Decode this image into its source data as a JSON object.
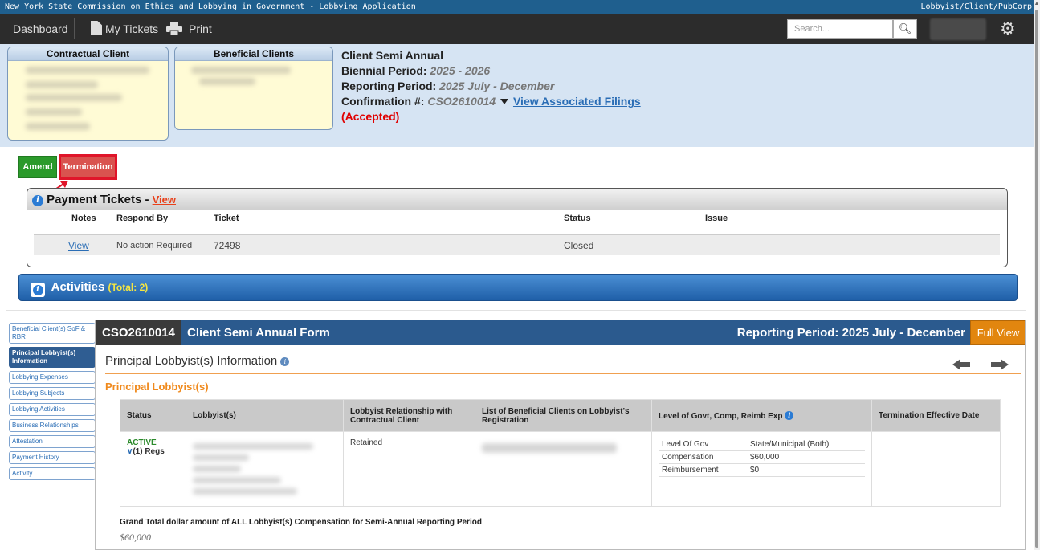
{
  "app": {
    "title": "New York State Commission on Ethics and Lobbying in Government - Lobbying Application",
    "role": "Lobbyist/Client/PubCorp"
  },
  "nav": {
    "dashboard": "Dashboard",
    "my_tickets": "My Tickets",
    "print": "Print",
    "search_placeholder": "Search...",
    "search_icon": "search-icon",
    "settings_icon": "gear-icon"
  },
  "header": {
    "contractual_client": "Contractual Client",
    "beneficial_clients": "Beneficial Clients",
    "form_name": "Client Semi Annual",
    "biennial_label": "Biennial Period:",
    "biennial_value": "2025 - 2026",
    "reporting_label": "Reporting Period:",
    "reporting_value": "2025 July - December",
    "confirmation_label": "Confirmation #:",
    "confirmation_value": "CSO2610014",
    "associated_link": "View Associated Filings",
    "status": "(Accepted)"
  },
  "actions": {
    "amend": "Amend",
    "termination": "Termination"
  },
  "payment_tickets": {
    "title": "Payment Tickets - ",
    "view_link": "View",
    "columns": [
      "Notes",
      "Respond By",
      "Ticket",
      "Status",
      "Issue"
    ],
    "rows": [
      {
        "notes": "View",
        "respond_by": "No action Required",
        "ticket": "72498",
        "status": "Closed",
        "issue": ""
      }
    ]
  },
  "activities": {
    "title": "Activities",
    "total": "(Total: 2)"
  },
  "sidebar": {
    "items": [
      {
        "label": "Beneficial Client(s) SoF & RBR",
        "active": false
      },
      {
        "label": "Principal Lobbyist(s) Information",
        "active": true
      },
      {
        "label": "Lobbying Expenses",
        "active": false
      },
      {
        "label": "Lobbying Subjects",
        "active": false
      },
      {
        "label": "Lobbying Activities",
        "active": false
      },
      {
        "label": "Business Relationships",
        "active": false
      },
      {
        "label": "Attestation",
        "active": false
      },
      {
        "label": "Payment History",
        "active": false
      },
      {
        "label": "Activity",
        "active": false
      }
    ]
  },
  "form": {
    "id": "CSO2610014",
    "title": "Client Semi Annual Form",
    "period": "Reporting Period: 2025 July - December",
    "full_view": "Full View",
    "section_title": "Principal Lobbyist(s) Information",
    "subsection_title": "Principal Lobbyist(s)",
    "table": {
      "columns": [
        "Status",
        "Lobbyist(s)",
        "Lobbyist Relationship with Contractual Client",
        "List of Beneficial Clients on Lobbyist's Registration",
        "Level of Govt, Comp, Reimb Exp",
        "Termination Effective Date"
      ],
      "row": {
        "status": "ACTIVE",
        "regs": "(1) Regs",
        "relationship": "Retained",
        "level_of_gov_label": "Level Of Gov",
        "level_of_gov_value": "State/Municipal (Both)",
        "compensation_label": "Compensation",
        "compensation_value": "$60,000",
        "reimbursement_label": "Reimbursement",
        "reimbursement_value": "$0",
        "termination_date": ""
      }
    },
    "grand_total_label": "Grand Total dollar amount of ALL Lobbyist(s) Compensation for Semi-Annual Reporting Period",
    "grand_total_value": "$60,000"
  },
  "colors": {
    "title_bar": "#1f5f8e",
    "navbar": "#2c2c2c",
    "header_bg": "#d6e4f3",
    "amend": "#2b9a2b",
    "termination": "#d9534f",
    "accepted": "#e00000",
    "activities_bar": "#2b6bb8",
    "form_header": "#2b5a8e",
    "full_view": "#e2860f",
    "subsection": "#f08a1d"
  }
}
